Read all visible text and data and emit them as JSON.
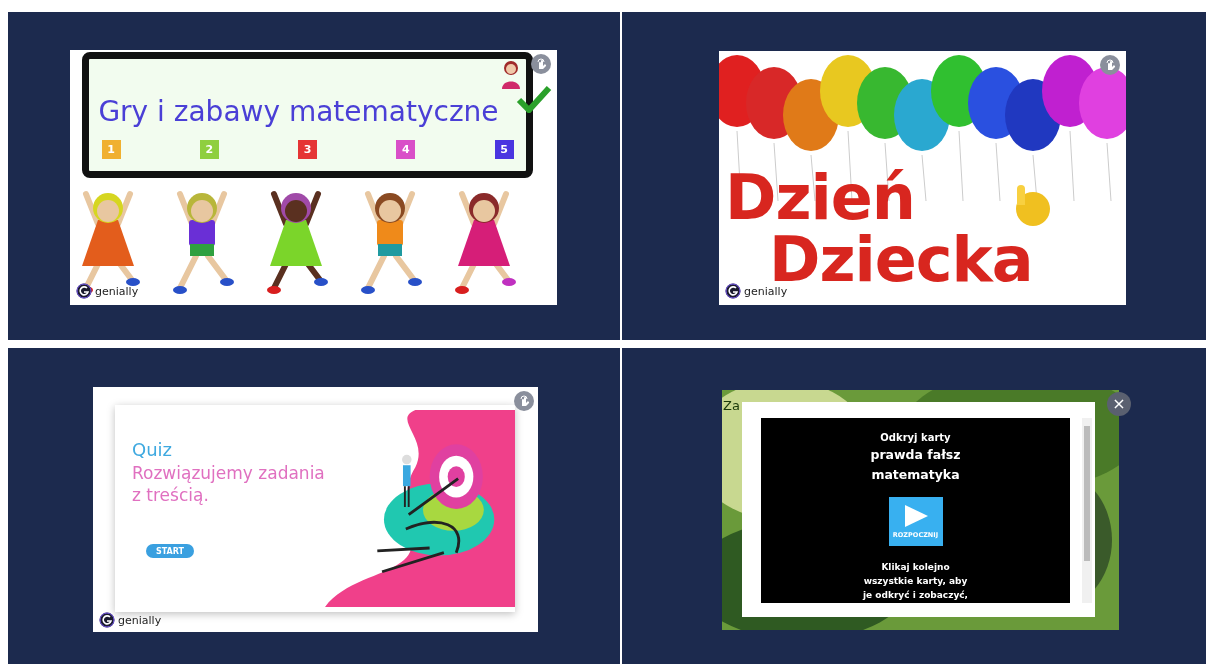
{
  "panels": [
    {
      "kind": "kids",
      "title": "Gry i zabawy matematyczne",
      "numbers": [
        {
          "label": "1",
          "color": "#f0b030"
        },
        {
          "label": "2",
          "color": "#8fcf3f"
        },
        {
          "label": "3",
          "color": "#e53535"
        },
        {
          "label": "4",
          "color": "#d94fc8"
        },
        {
          "label": "5",
          "color": "#4a35e0"
        }
      ],
      "brand": "genially"
    },
    {
      "kind": "balloons",
      "lines": [
        "Dzień",
        "Dziecka"
      ],
      "brand": "genially"
    },
    {
      "kind": "quiz",
      "heading": "Quiz",
      "subtitle": [
        "Rozwiązujemy zadania",
        "z treścią."
      ],
      "button": "START",
      "brand": "genially"
    },
    {
      "kind": "cards",
      "slide_text": "Za",
      "close": "×",
      "lines": [
        "Odkryj karty",
        "prawda fałsz",
        "matematyka"
      ],
      "play_label": "ROZPOCZNIJ",
      "instructions": [
        "Klikaj kolejno",
        "wszystkie karty, aby",
        "je odkryć i zobaczyć,"
      ]
    }
  ]
}
